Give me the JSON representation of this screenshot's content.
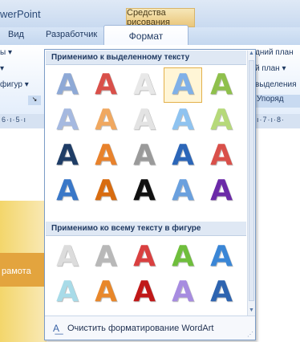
{
  "window": {
    "app_title": "werPoint",
    "context_tab_group": "Средства рисования"
  },
  "tabs": [
    {
      "label": "Вид"
    },
    {
      "label": "Разработчик"
    },
    {
      "label": "Формат",
      "active": true
    }
  ],
  "ribbon": {
    "left": [
      "ы ▾",
      "▾",
      "фигур ▾"
    ],
    "right": [
      "дний план",
      "й план ▾",
      "выделения"
    ],
    "group_caption": "Упоряд"
  },
  "ruler": {
    "left": "6·ı·5·ı",
    "right": "ı·7·ı·8·"
  },
  "slide": {
    "text": "рамота"
  },
  "gallery": {
    "section1": {
      "title": "Применимо к выделенному тексту",
      "glyph": "A",
      "colors": [
        [
          "#8ea9d6",
          "#d9504a",
          "#e8e8e8",
          "#7fb0e8",
          "#8fc04c"
        ],
        [
          "#a5b9e0",
          "#f0a860",
          "#e3e3e3",
          "#8fc3f0",
          "#b6d97a"
        ],
        [
          "#1f3d66",
          "#e8822c",
          "#9a9a9a",
          "#2c66b8",
          "#d9504a"
        ],
        [
          "#3a78c8",
          "#d86c10",
          "#111111",
          "#6aa0de",
          "#6b2aa8"
        ]
      ],
      "selected_index": 3
    },
    "section2": {
      "title": "Применимо ко всему тексту в фигуре",
      "glyph": "A",
      "colors": [
        [
          "#dcdcdc",
          "#b8b8b8",
          "#d94040",
          "#6fbe3c",
          "#3a86d6"
        ],
        [
          "#a8dbe8",
          "#e8872a",
          "#c01818",
          "#a78ce0",
          "#2e64b0"
        ]
      ]
    },
    "clear_label": "Очистить форматирование WordArt",
    "clear_icon": "clear-format-icon"
  }
}
